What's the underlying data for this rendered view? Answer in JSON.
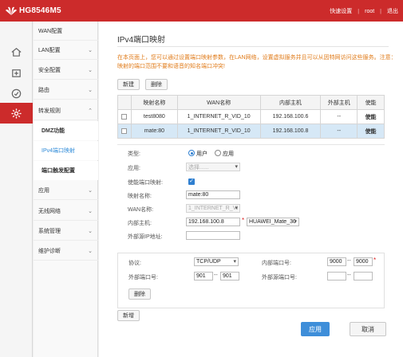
{
  "header": {
    "brand": "HG8546M5",
    "links": [
      "快速设置",
      "root",
      "退出"
    ]
  },
  "colors": {
    "brand_red": "#cc2b2b",
    "accent_blue": "#3e8ed9",
    "notice_orange": "#e07b1a",
    "selected_row": "#d6e8f6"
  },
  "icons": [
    "home-icon",
    "add-icon",
    "status-icon",
    "gear-icon"
  ],
  "nav": {
    "items": [
      {
        "label": "WAN配置"
      },
      {
        "label": "LAN配置"
      },
      {
        "label": "安全配置"
      },
      {
        "label": "路由"
      },
      {
        "label": "转发规则"
      },
      {
        "label": "DMZ功能"
      },
      {
        "label": "IPv4端口映射"
      },
      {
        "label": "端口触发配置"
      },
      {
        "label": "应用"
      },
      {
        "label": "无线网络"
      },
      {
        "label": "系统管理"
      },
      {
        "label": "维护诊断"
      }
    ]
  },
  "page": {
    "title": "IPv4端口映射",
    "notice": "在本页面上，您可以通过设置端口映射参数，在LAN网络，设置虚拟服务并且可以从因特网访问这些服务。注意：映射的端口范围不要和语音的知名端口冲突!",
    "new_button": "新建",
    "delete_button": "删除"
  },
  "table": {
    "headers": [
      "",
      "映射名称",
      "WAN名称",
      "内部主机",
      "外部主机",
      "使能"
    ],
    "rows": [
      {
        "name": "test8080",
        "wan": "1_INTERNET_R_VID_10",
        "internal_host": "192.168.100.6",
        "external_host": "--",
        "enable": "使能",
        "selected": false
      },
      {
        "name": "mate:80",
        "wan": "1_INTERNET_R_VID_10",
        "internal_host": "192.168.100.8",
        "external_host": "--",
        "enable": "使能",
        "selected": true
      }
    ]
  },
  "form": {
    "type_label": "类型:",
    "type_options": [
      "用户",
      "应用"
    ],
    "type_selected": "用户",
    "app_label": "应用:",
    "app_placeholder": "选择......",
    "enable_label": "使能端口映射:",
    "enable_checked": true,
    "name_label": "映射名称:",
    "name_value": "mate:80",
    "wan_label": "WAN名称:",
    "wan_value": "1_INTERNET_R_VI",
    "internal_host_label": "内部主机:",
    "internal_host_value": "192.168.100.8",
    "internal_host_select": "HUAWEI_Mate_30",
    "external_ip_label": "外部源IP地址:",
    "external_ip_value": ""
  },
  "ports": {
    "protocol_label": "协议:",
    "protocol_value": "TCP/UDP",
    "internal_port_label": "内部端口号:",
    "internal_port_start": "9000",
    "internal_port_end": "9000",
    "external_port_label": "外部端口号:",
    "external_port_start": "901",
    "external_port_end": "901",
    "external_src_port_label": "外部源端口号:",
    "external_src_port_start": "",
    "external_src_port_end": "",
    "delete_label": "删除",
    "dash": "--"
  },
  "actions": {
    "add_label": "新增",
    "apply_label": "应用",
    "cancel_label": "取消"
  }
}
